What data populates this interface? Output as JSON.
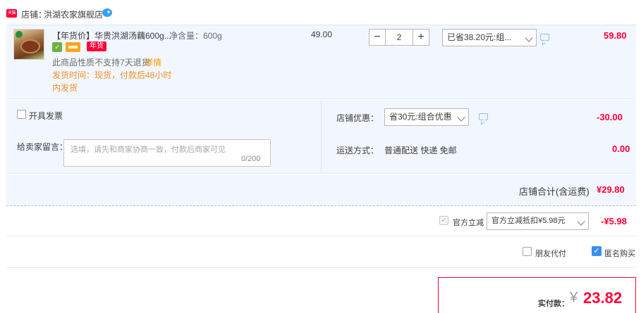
{
  "shop": {
    "badge_text": "天猫",
    "label": "店铺：",
    "name": "洪湖农家旗舰店",
    "icon": "wangwang-chat-icon"
  },
  "item": {
    "title": "【年货价】华贵洪湖汤藕600g...",
    "spec": "净含量：600g",
    "service_icons": [
      "guarantee-icon",
      "card-payment-icon"
    ],
    "tag": "年货",
    "no_return_text": "此商品性质不支持7天退货",
    "details_link": "详情",
    "ship_time_line1": "发货时间：现货，付款后48小时",
    "ship_time_line2": "内发货",
    "unit_price": "49.00",
    "quantity": "2",
    "qty_minus": "−",
    "qty_plus": "+",
    "promo_selected": "已省38.20元:组...",
    "line_total": "59.80"
  },
  "options": {
    "invoice_label": "开具发票",
    "memo_label": "给卖家留言：",
    "memo_placeholder": "选填，请先和商家协商一致，付款后商家可见",
    "memo_count": "0/200",
    "shop_discount_label": "店铺优惠：",
    "shop_discount_selected": "省30元:组合优惠",
    "shop_discount_amount": "-30.00",
    "shipping_label": "运送方式：",
    "shipping_method": "普通配送 快递 免邮",
    "shipping_fee": "0.00"
  },
  "subtotal": {
    "label": "店铺合计(含运费)",
    "amount": "¥29.80"
  },
  "official": {
    "label": "官方立减",
    "selected": "官方立减抵扣¥5.98元",
    "amount": "-¥5.98",
    "checked": true
  },
  "extras": {
    "friend_pay_label": "朋友代付",
    "anonymous_label": "匿名购买",
    "anonymous_checked": true
  },
  "payment": {
    "label": "实付款：",
    "currency": "¥",
    "amount": "23.82"
  },
  "colors": {
    "accent_red": "#ff0036",
    "panel_blue": "#f2f6fe",
    "checkbox_blue": "#3b8ef0",
    "warning_orange": "#f29222"
  }
}
